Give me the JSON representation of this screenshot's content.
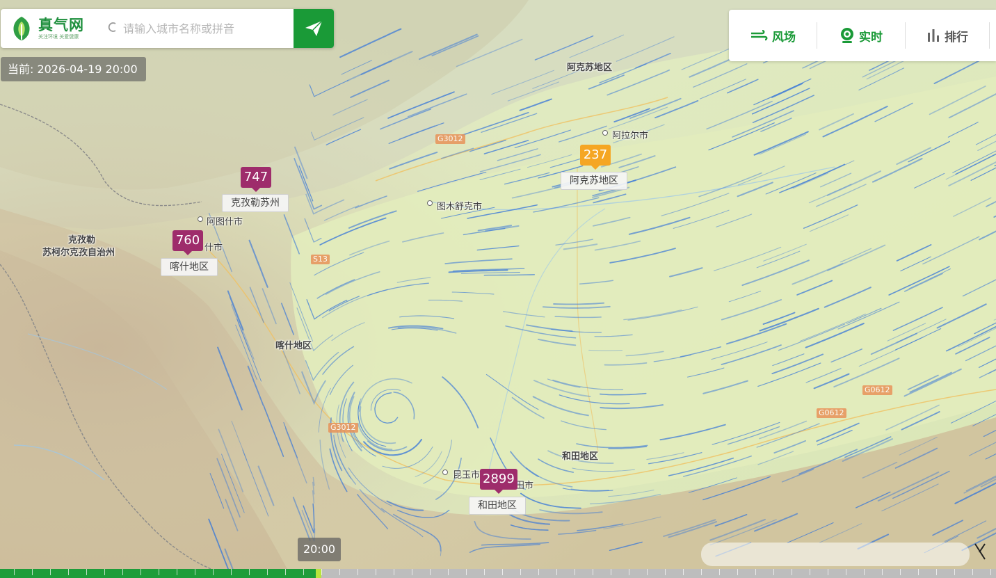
{
  "search": {
    "logo_name": "真气网",
    "logo_slogan": "关注环境  关爱健康",
    "placeholder": "请输入城市名称或拼音"
  },
  "current_time": "当前: 2026-04-19 20:00",
  "toolbar": {
    "wind_label": "风场",
    "live_label": "实时",
    "rank_label": "排行"
  },
  "map_labels": [
    {
      "text": "阿克苏地区",
      "kind": "region"
    },
    {
      "text": "阿拉尔市",
      "kind": "city"
    },
    {
      "text": "图木舒克市",
      "kind": "city"
    },
    {
      "text": "阿图什市",
      "kind": "city"
    },
    {
      "text": "克孜勒",
      "kind": "region"
    },
    {
      "text": "苏柯尔克孜自治州",
      "kind": "region"
    },
    {
      "text": "喀什地区",
      "kind": "region"
    },
    {
      "text": "和田地区",
      "kind": "region"
    },
    {
      "text": "昆玉市",
      "kind": "city"
    },
    {
      "text": "和田市",
      "kind": "city"
    },
    {
      "text": "什市",
      "kind": "city"
    }
  ],
  "roads": [
    "G3012",
    "S13",
    "G3012",
    "G0612",
    "G0612"
  ],
  "aqi_markers": [
    {
      "value": "747",
      "name": "克孜勒苏州",
      "level": "purple"
    },
    {
      "value": "760",
      "name": "喀什地区",
      "level": "purple"
    },
    {
      "value": "237",
      "name": "阿克苏地区",
      "level": "orange"
    },
    {
      "value": "2899",
      "name": "和田地区",
      "level": "purple"
    }
  ],
  "timeline": {
    "current_label": "20:00",
    "progress": 0.317
  },
  "colors": {
    "brand_green": "#1a9a37",
    "aqi_purple": "#9e2c6b",
    "aqi_orange": "#f5a623",
    "wind_blue": "#3a78d8"
  },
  "icons": [
    "location-icon",
    "send-icon",
    "wind-icon",
    "live-camera-icon",
    "ranking-bars-icon"
  ]
}
